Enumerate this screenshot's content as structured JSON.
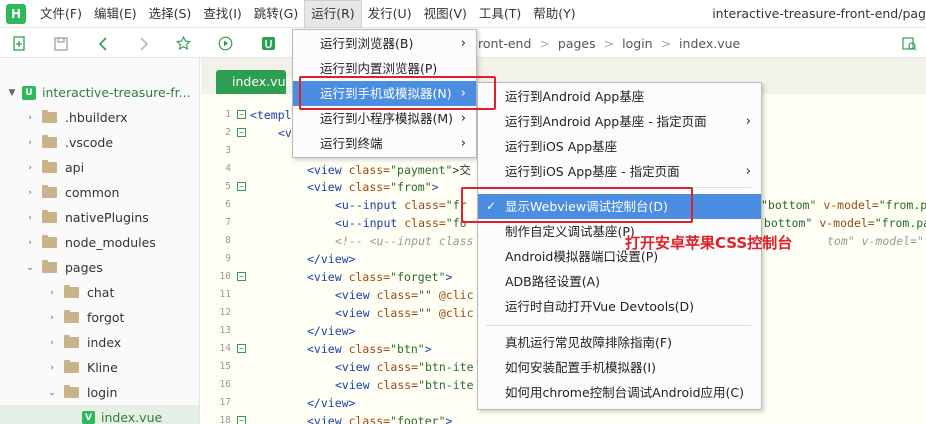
{
  "menubar": {
    "logo": "H",
    "items": [
      "文件(F)",
      "编辑(E)",
      "选择(S)",
      "查找(I)",
      "跳转(G)",
      "运行(R)",
      "发行(U)",
      "视图(V)",
      "工具(T)",
      "帮助(Y)"
    ],
    "title": "interactive-treasure-front-end/pag"
  },
  "toolbar": {
    "breadcrumb": [
      "ront-end",
      "pages",
      "login",
      "index.vue"
    ]
  },
  "sidebar": {
    "project": "interactive-treasure-fr...",
    "items": [
      ".hbuilderx",
      ".vscode",
      "api",
      "common",
      "nativePlugins",
      "node_modules",
      "pages",
      "chat",
      "forgot",
      "index",
      "Kline",
      "login",
      "index.vue"
    ]
  },
  "editor": {
    "tab_label": "index.vue",
    "line_numbers": [
      "1",
      "2",
      "3",
      "4",
      "5",
      "6",
      "7",
      "8",
      "9",
      "10",
      "11",
      "12",
      "13",
      "14",
      "15",
      "16",
      "17",
      "18"
    ]
  },
  "run_menu": {
    "items": [
      "运行到浏览器(B)",
      "运行到内置浏览器(P)",
      "运行到手机或模拟器(N)",
      "运行到小程序模拟器(M)",
      "运行到终端"
    ]
  },
  "device_menu": {
    "items": [
      "运行到Android App基座",
      "运行到Android App基座 - 指定页面",
      "运行到iOS App基座",
      "运行到iOS App基座 - 指定页面",
      "显示Webview调试控制台(D)",
      "制作自定义调试基座(P)",
      "Android模拟器端口设置(P)",
      "ADB路径设置(A)",
      "运行时自动打开Vue Devtools(D)",
      "真机运行常见故障排除指南(F)",
      "如何安装配置手机模拟器(I)",
      "如何用chrome控制台调试Android应用(C)"
    ],
    "check_mark": "✓"
  },
  "annotation": "打开安卓苹果CSS控制台",
  "code": {
    "l1": "<templ",
    "l2": "<v",
    "l4_tag": "<view",
    "l4_class": "class=",
    "l4_val": "\"payment\"",
    "l4_rest": ">交",
    "l5_tag": "<view",
    "l5_class": "class=",
    "l5_val": "\"from\"",
    "l5_end": ">",
    "l6_tag": "<u--input",
    "l6_class": "class=",
    "l6_val": "\"fr",
    "l6_r1": "\"bottom\"",
    "l6_r2": "v-model=",
    "l6_r3": "\"from.p",
    "l7_tag": "<u--input",
    "l7_class": "class=",
    "l7_val": "\"fo",
    "l7_r1": "\"bottom\"",
    "l7_r2": "v-model=",
    "l7_r3": "\"from.pas",
    "l8": "<!-- <u--input class",
    "l8_r": "tom\" v-model=\"f",
    "l9": "</view>",
    "l10_tag": "<view",
    "l10_class": "class=",
    "l10_val": "\"forget\"",
    "l10_end": ">",
    "l11_tag": "<view",
    "l11_class": "class=",
    "l11_val": "\"\"",
    "l11_rest": "@clic",
    "l12_tag": "<view",
    "l12_class": "class=",
    "l12_val": "\"\"",
    "l12_rest": "@clic",
    "l13": "</view>",
    "l14_tag": "<view",
    "l14_class": "class=",
    "l14_val": "\"btn\"",
    "l14_end": ">",
    "l15_tag": "<view",
    "l15_class": "class=",
    "l15_val": "\"btn-ite",
    "l16_tag": "<view",
    "l16_class": "class=",
    "l16_val": "\"btn-ite",
    "l17": "</view>",
    "l18_tag": "<view",
    "l18_class": "class=",
    "l18_val": "\"footer\"",
    "l18_end": ">"
  }
}
